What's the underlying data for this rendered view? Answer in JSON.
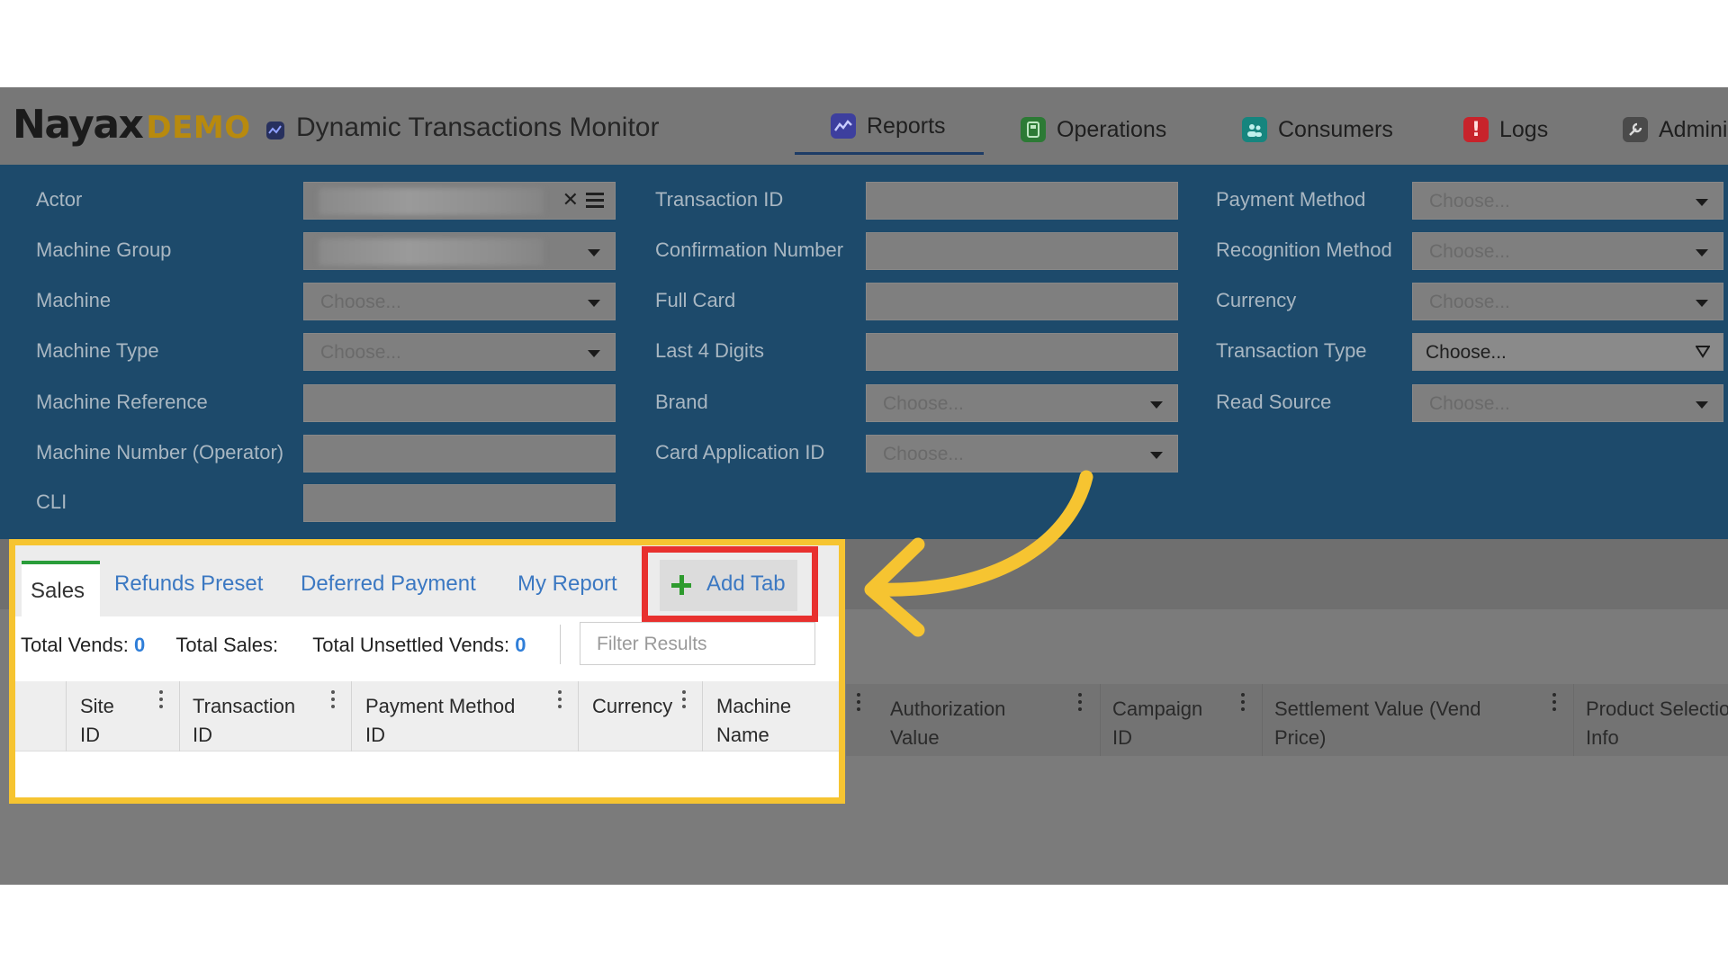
{
  "header": {
    "logo_main": "Nayax",
    "logo_demo": "DEMO",
    "app_title": "Dynamic Transactions Monitor",
    "nav": [
      {
        "label": "Reports",
        "icon": "reports-icon",
        "color": "#4a4fc4"
      },
      {
        "label": "Operations",
        "icon": "operations-icon",
        "color": "#2e8b3a"
      },
      {
        "label": "Consumers",
        "icon": "consumers-icon",
        "color": "#1b9a92"
      },
      {
        "label": "Logs",
        "icon": "logs-icon",
        "color": "#d9262f"
      },
      {
        "label": "Admini",
        "icon": "admin-icon",
        "color": "#555555"
      }
    ]
  },
  "filters": {
    "actor": {
      "label": "Actor"
    },
    "machine_group": {
      "label": "Machine Group"
    },
    "machine": {
      "label": "Machine",
      "placeholder": "Choose..."
    },
    "machine_type": {
      "label": "Machine Type",
      "placeholder": "Choose..."
    },
    "machine_reference": {
      "label": "Machine Reference"
    },
    "machine_number": {
      "label": "Machine Number (Operator)"
    },
    "cli": {
      "label": "CLI"
    },
    "transaction_id": {
      "label": "Transaction ID"
    },
    "confirmation_number": {
      "label": "Confirmation Number"
    },
    "full_card": {
      "label": "Full Card"
    },
    "last4": {
      "label": "Last 4 Digits"
    },
    "brand": {
      "label": "Brand",
      "placeholder": "Choose..."
    },
    "card_app_id": {
      "label": "Card Application ID",
      "placeholder": "Choose..."
    },
    "payment_method": {
      "label": "Payment Method",
      "placeholder": "Choose..."
    },
    "recognition_method": {
      "label": "Recognition Method",
      "placeholder": "Choose..."
    },
    "currency": {
      "label": "Currency",
      "placeholder": "Choose..."
    },
    "transaction_type": {
      "label": "Transaction Type",
      "placeholder": "Choose..."
    },
    "read_source": {
      "label": "Read Source",
      "placeholder": "Choose..."
    }
  },
  "tabs": {
    "sales": "Sales",
    "refunds": "Refunds Preset",
    "deferred": "Deferred Payment",
    "my_report": "My Report",
    "add_tab": "Add Tab"
  },
  "stats": {
    "total_vends_label": "Total Vends:",
    "total_vends_value": "0",
    "total_sales_label": "Total Sales:",
    "total_unsettled_label": "Total Unsettled Vends:",
    "total_unsettled_value": "0"
  },
  "filter_results": {
    "placeholder": "Filter Results"
  },
  "columns": {
    "site_id": [
      "Site",
      "ID"
    ],
    "transaction_id": [
      "Transaction",
      "ID"
    ],
    "payment_method_id": [
      "Payment Method",
      "ID"
    ],
    "currency": [
      "Currency"
    ],
    "machine_name": [
      "Machine",
      "Name"
    ],
    "authorization_value": [
      "Authorization",
      "Value"
    ],
    "campaign_id": [
      "Campaign",
      "ID"
    ],
    "settlement_value": [
      "Settlement Value (Vend",
      "Price)"
    ],
    "product_selection": [
      "Product Selectio",
      "Info"
    ]
  },
  "colors": {
    "highlight_frame": "#f6c431",
    "add_tab_box": "#e8302e",
    "filter_panel": "#1d4a6b",
    "link": "#3b78c2",
    "active_tab_accent": "#2a9d3a"
  }
}
